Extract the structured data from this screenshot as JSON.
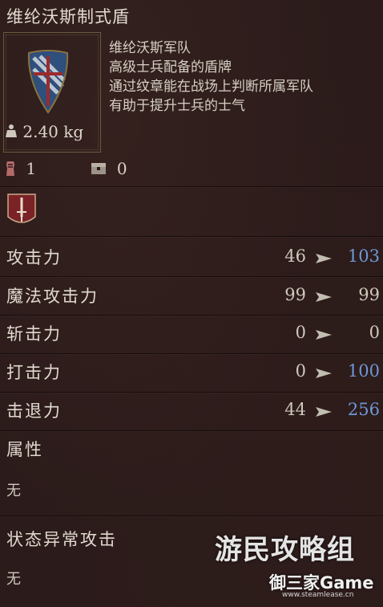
{
  "item": {
    "name": "维纶沃斯制式盾",
    "weight": "2.40 kg",
    "description": [
      "维纶沃斯军队",
      "高级士兵配备的盾牌",
      "通过纹章能在战场上判断所属军队",
      "有助于提升士兵的士气"
    ],
    "owned_count": "1",
    "storage_count": "0"
  },
  "stats": [
    {
      "label": "攻击力",
      "current": "46",
      "new": "103",
      "trend": "up"
    },
    {
      "label": "魔法攻击力",
      "current": "99",
      "new": "99",
      "trend": "same"
    },
    {
      "label": "斩击力",
      "current": "0",
      "new": "0",
      "trend": "same"
    },
    {
      "label": "打击力",
      "current": "0",
      "new": "100",
      "trend": "up"
    },
    {
      "label": "击退力",
      "current": "44",
      "new": "256",
      "trend": "up"
    }
  ],
  "attribute": {
    "label": "属性",
    "value": "无"
  },
  "status_attack": {
    "label": "状态异常攻击",
    "value": "无"
  },
  "watermark": {
    "line1": "游民攻略组",
    "line2": "御三家Game",
    "line3": "www.steamlease.cn"
  },
  "colors": {
    "increase": "#6f97d8",
    "unchanged": "#cfc8bc",
    "background": "#2b1b1a"
  },
  "icons": {
    "weight": "weight-icon",
    "owned": "hand-icon",
    "storage": "chest-icon",
    "category": "sword-badge-icon",
    "shield": "shield-icon"
  }
}
